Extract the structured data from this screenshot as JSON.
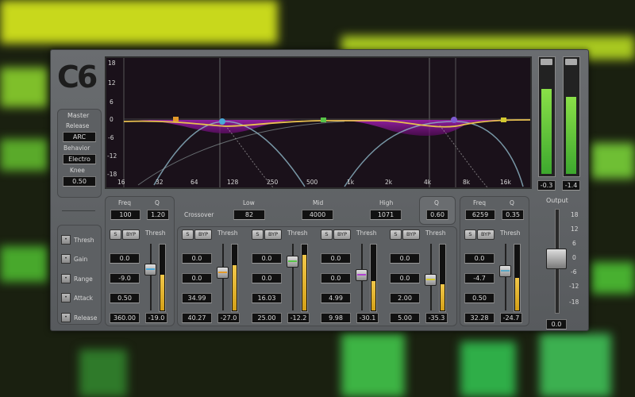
{
  "logo": "C6",
  "master": {
    "title": "Master",
    "release_label": "Release",
    "release_value": "ARC",
    "behavior_label": "Behavior",
    "behavior_value": "Electro",
    "knee_label": "Knee",
    "knee_value": "0.50"
  },
  "row_labels": [
    "Thresh",
    "Gain",
    "Range",
    "Attack",
    "Release"
  ],
  "graph": {
    "y_ticks": [
      "18",
      "12",
      "6",
      "0",
      "-6",
      "-12",
      "-18"
    ],
    "x_ticks": [
      "16",
      "32",
      "64",
      "128",
      "250",
      "500",
      "1k",
      "2k",
      "4k",
      "8k",
      "16k"
    ]
  },
  "output_meters": {
    "left": "-0.3",
    "right": "-1.4"
  },
  "output": {
    "label": "Output",
    "scale": [
      "18",
      "12",
      "6",
      "0",
      "-6",
      "-12",
      "-18"
    ],
    "value": "0.0"
  },
  "crossover": {
    "label": "Crossover",
    "low_label": "Low",
    "low_value": "82",
    "mid_label": "Mid",
    "mid_value": "4000",
    "high_label": "High",
    "high_value": "1071",
    "q_label": "Q",
    "q_value": "0.60"
  },
  "common": {
    "solo": "S",
    "bypass": "BYP",
    "thresh": "Thresh"
  },
  "bands": [
    {
      "id": "band1",
      "freq_label": "Freq",
      "freq": "100",
      "q_label": "Q",
      "q": "1.20",
      "values": [
        "0.0",
        "-9.0",
        "0.50",
        "360.00"
      ],
      "thresh": "-19.0",
      "color": "#4aa8d8",
      "fill": 0.55,
      "fader": 0.3
    },
    {
      "id": "band2",
      "values": [
        "0.0",
        "0.0",
        "34.99",
        "40.27"
      ],
      "thresh": "-27.0",
      "color": "#e39a2a",
      "fill": 0.7,
      "fader": 0.35
    },
    {
      "id": "band3",
      "values": [
        "0.0",
        "0.0",
        "16.03",
        "25.00"
      ],
      "thresh": "-12.2",
      "color": "#58c548",
      "fill": 0.85,
      "fader": 0.18
    },
    {
      "id": "band4",
      "values": [
        "0.0",
        "0.0",
        "4.99",
        "9.98"
      ],
      "thresh": "-30.1",
      "color": "#b043d0",
      "fill": 0.45,
      "fader": 0.38
    },
    {
      "id": "band5",
      "values": [
        "0.0",
        "0.0",
        "2.00",
        "5.00"
      ],
      "thresh": "-35.3",
      "color": "#d2c830",
      "fill": 0.4,
      "fader": 0.45
    },
    {
      "id": "band6",
      "freq_label": "Freq",
      "freq": "6259",
      "q_label": "Q",
      "q": "0.35",
      "values": [
        "0.0",
        "-4.7",
        "0.50",
        "32.28"
      ],
      "thresh": "-24.7",
      "color": "#59a7c5",
      "fill": 0.5,
      "fader": 0.32
    }
  ]
}
